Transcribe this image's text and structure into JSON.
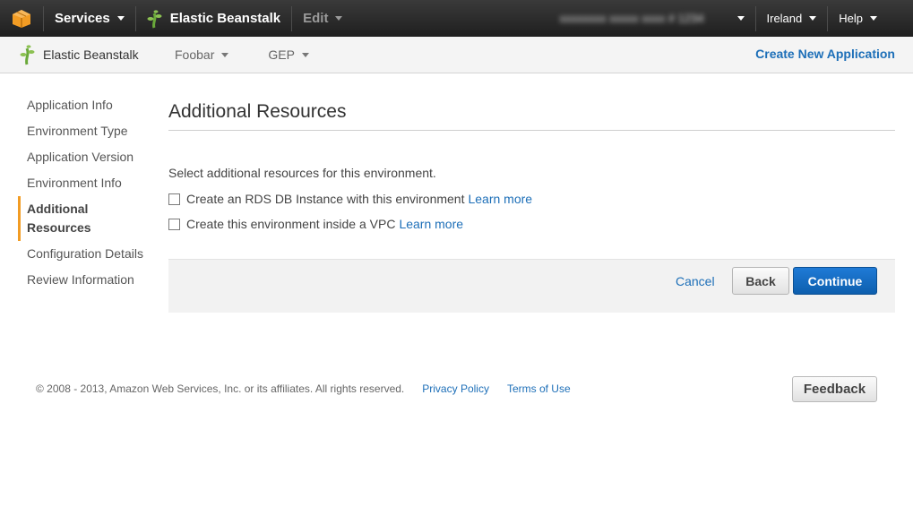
{
  "topbar": {
    "services_label": "Services",
    "service_name": "Elastic Beanstalk",
    "edit_label": "Edit",
    "account_label": "xxxxxxxx xxxxx xxxx # 1234",
    "region_label": "Ireland",
    "help_label": "Help"
  },
  "subbar": {
    "brand_label": "Elastic Beanstalk",
    "app_menu": "Foobar",
    "env_menu": "GEP",
    "create_app_label": "Create New Application"
  },
  "sidebar": {
    "items": [
      {
        "label": "Application Info"
      },
      {
        "label": "Environment Type"
      },
      {
        "label": "Application Version"
      },
      {
        "label": "Environment Info"
      },
      {
        "label": "Additional Resources"
      },
      {
        "label": "Configuration Details"
      },
      {
        "label": "Review Information"
      }
    ],
    "active_index": 4
  },
  "main": {
    "title": "Additional Resources",
    "intro": "Select additional resources for this environment.",
    "options": [
      {
        "label": "Create an RDS DB Instance with this environment",
        "link": "Learn more",
        "checked": false
      },
      {
        "label": "Create this environment inside a VPC",
        "link": "Learn more",
        "checked": false
      }
    ],
    "cancel_label": "Cancel",
    "back_label": "Back",
    "continue_label": "Continue"
  },
  "footer": {
    "copyright": "© 2008 - 2013, Amazon Web Services, Inc. or its affiliates. All rights reserved.",
    "privacy_label": "Privacy Policy",
    "terms_label": "Terms of Use",
    "feedback_label": "Feedback"
  },
  "colors": {
    "accent": "#f29c24",
    "link": "#1d6fb8",
    "primary_button": "#1372c6",
    "topbar": "#2b2b2b"
  },
  "icons": {
    "aws_logo": "aws-cube-icon",
    "beanstalk": "beanstalk-icon"
  }
}
